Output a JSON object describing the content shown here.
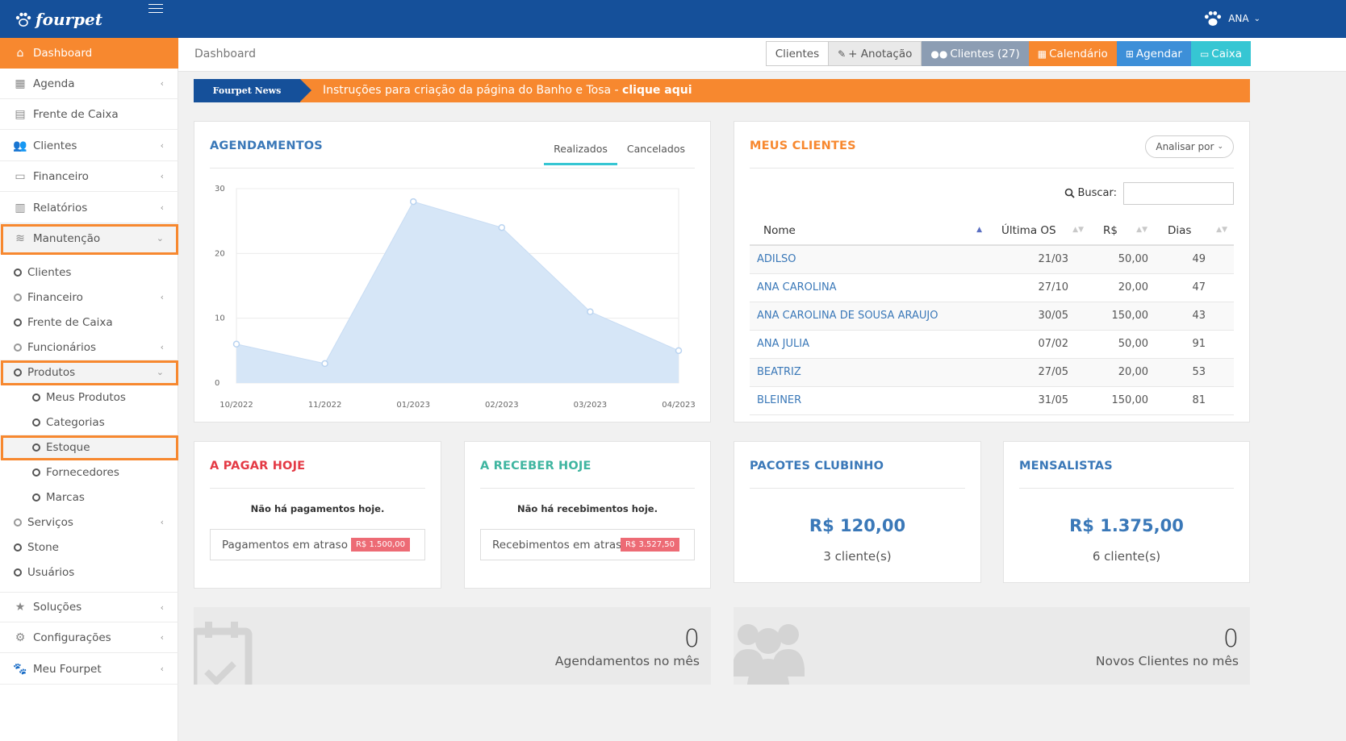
{
  "app": {
    "brand": "fourpet",
    "user": "ANA"
  },
  "sidebar": {
    "items": [
      {
        "label": "Dashboard"
      },
      {
        "label": "Agenda"
      },
      {
        "label": "Frente de Caixa"
      },
      {
        "label": "Clientes"
      },
      {
        "label": "Financeiro"
      },
      {
        "label": "Relatórios"
      },
      {
        "label": "Manutenção"
      }
    ],
    "sub": [
      {
        "label": "Clientes"
      },
      {
        "label": "Financeiro"
      },
      {
        "label": "Frente de Caixa"
      },
      {
        "label": "Funcionários"
      },
      {
        "label": "Produtos"
      },
      {
        "label": "Meus Produtos"
      },
      {
        "label": "Categorias"
      },
      {
        "label": "Estoque"
      },
      {
        "label": "Fornecedores"
      },
      {
        "label": "Marcas"
      },
      {
        "label": "Serviços"
      },
      {
        "label": "Stone"
      },
      {
        "label": "Usuários"
      }
    ],
    "bottom": [
      {
        "label": "Soluções"
      },
      {
        "label": "Configurações"
      },
      {
        "label": "Meu Fourpet"
      }
    ]
  },
  "header": {
    "breadcrumb": "Dashboard",
    "buttons": {
      "clientes": "Clientes",
      "anotacao": "+ Anotação",
      "clientes27": "Clientes (27)",
      "calendario": "Calendário",
      "agendar": "Agendar",
      "caixa": "Caixa"
    }
  },
  "news": {
    "tag": "Fourpet News",
    "text": "Instruções para criação da página do Banho e Tosa - ",
    "link": "clique aqui"
  },
  "agendamentos": {
    "title": "AGENDAMENTOS",
    "tabs": [
      "Realizados",
      "Cancelados"
    ]
  },
  "chart_data": {
    "type": "area",
    "categories": [
      "10/2022",
      "11/2022",
      "01/2023",
      "02/2023",
      "03/2023",
      "04/2023"
    ],
    "values": [
      6,
      3,
      28,
      24,
      11,
      5
    ],
    "ylim": [
      0,
      30
    ],
    "yticks": [
      0,
      10,
      20,
      30
    ],
    "grid": true,
    "color": "#d6e6f7"
  },
  "clientes": {
    "title": "MEUS CLIENTES",
    "analisar": "Analisar por",
    "search_label": "Buscar:",
    "columns": [
      "Nome",
      "Última OS",
      "R$",
      "Dias"
    ],
    "rows": [
      {
        "nome": "ADILSO",
        "os": "21/03",
        "valor": "50,00",
        "dias": "49"
      },
      {
        "nome": "ANA CAROLINA",
        "os": "27/10",
        "valor": "20,00",
        "dias": "47"
      },
      {
        "nome": "ANA CAROLINA DE SOUSA ARAUJO",
        "os": "30/05",
        "valor": "150,00",
        "dias": "43"
      },
      {
        "nome": "ANA JULIA",
        "os": "07/02",
        "valor": "50,00",
        "dias": "91"
      },
      {
        "nome": "BEATRIZ",
        "os": "27/05",
        "valor": "20,00",
        "dias": "53"
      },
      {
        "nome": "BLEINER",
        "os": "31/05",
        "valor": "150,00",
        "dias": "81"
      }
    ]
  },
  "pagar": {
    "title": "A PAGAR HOJE",
    "msg": "Não há pagamentos hoje.",
    "atraso": "Pagamentos em atraso",
    "badge": "R$ 1.500,00"
  },
  "receber": {
    "title": "A RECEBER HOJE",
    "msg": "Não há recebimentos hoje.",
    "atraso": "Recebimentos em atraso",
    "badge": "R$ 3.527,50"
  },
  "pacotes": {
    "title": "PACOTES CLUBINHO",
    "value": "R$ 120,00",
    "clients": "3 cliente(s)"
  },
  "mensalistas": {
    "title": "MENSALISTAS",
    "value": "R$ 1.375,00",
    "clients": "6 cliente(s)"
  },
  "stats": {
    "agendamentos": {
      "value": "0",
      "label": "Agendamentos no mês"
    },
    "novos": {
      "value": "0",
      "label": "Novos Clientes no mês"
    }
  },
  "colors": {
    "brand": "#15509a",
    "accent": "#f7882f",
    "teal": "#36c6d3",
    "red": "#e43a45",
    "link": "#3a78b8"
  }
}
